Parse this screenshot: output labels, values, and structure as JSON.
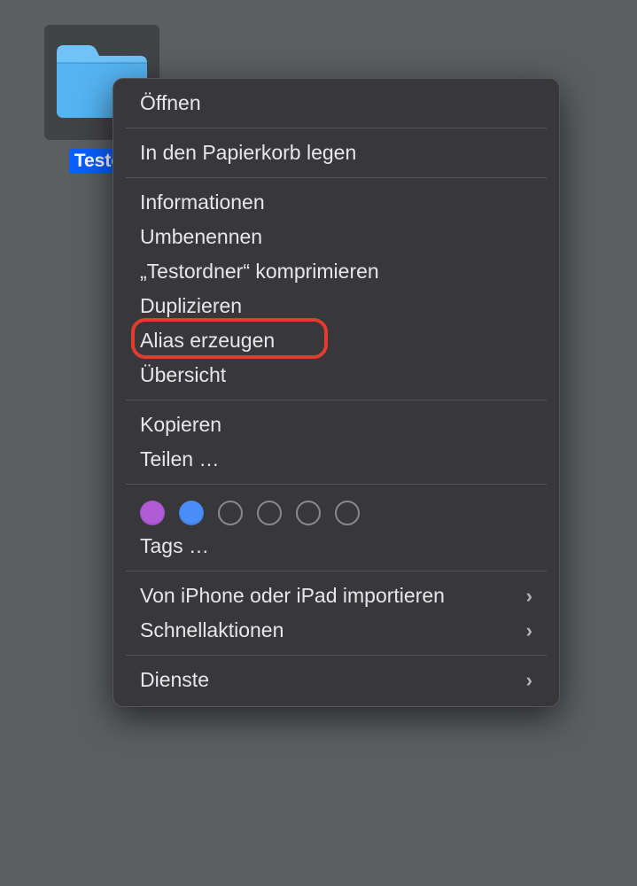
{
  "folder": {
    "label": "Testor"
  },
  "menu": {
    "open": "Öffnen",
    "trash": "In den Papierkorb legen",
    "info": "Informationen",
    "rename": "Umbenennen",
    "compress": "„Testordner“ komprimieren",
    "duplicate": "Duplizieren",
    "alias": "Alias erzeugen",
    "quicklook": "Übersicht",
    "copy": "Kopieren",
    "share": "Teilen …",
    "tags_label": "Tags …",
    "import": "Von iPhone oder iPad importieren",
    "quickactions": "Schnellaktionen",
    "services": "Dienste"
  },
  "tags": {
    "dots": [
      "purple",
      "blue",
      "empty",
      "empty",
      "empty",
      "empty"
    ]
  }
}
